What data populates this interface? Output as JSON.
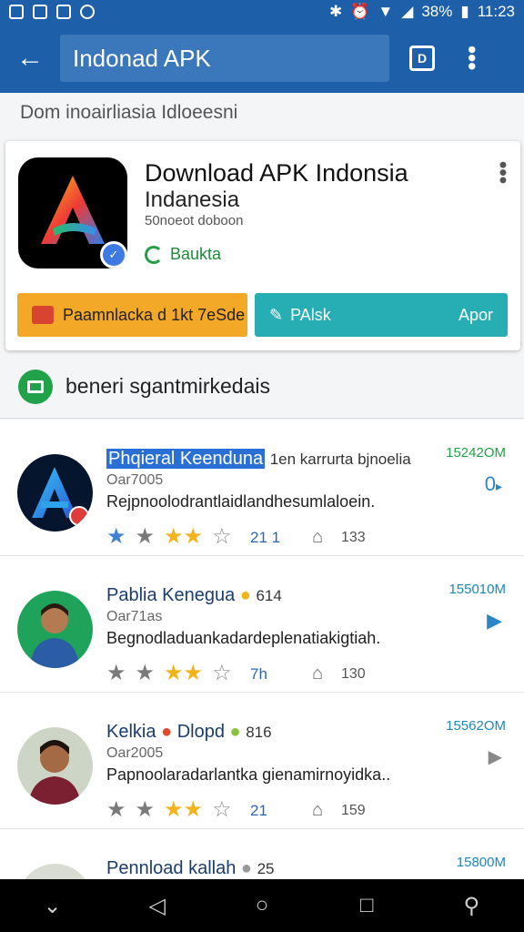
{
  "status_bar": {
    "battery": "38%",
    "time": "11:23"
  },
  "app_bar": {
    "search_text": "Indonad APK",
    "back_icon": "arrow-left-icon",
    "action_icon": "square-d-icon",
    "menu_icon": "more-vert-icon"
  },
  "subtitle": "Dom inoairliasia Idloeesni",
  "featured": {
    "title": "Download  APK Indonsia",
    "title_line2": "Indanesia",
    "developer": "50noeot doboon",
    "tag": "Baukta",
    "primary_button": "Paamnlacka d 1kt 7eSde",
    "secondary_button_left": "PAlsk",
    "secondary_button_right": "Apor"
  },
  "section": {
    "label": "beneri sgantmirkedais"
  },
  "list": [
    {
      "title_highlight": "Phqieral Keenduna",
      "title_rest": "1en karrurta bjnoelia",
      "sub": "Oar7005",
      "desc": "Rejpnoolodrantlaidlandhesumlaloein.",
      "size": "15242OM",
      "download": "0",
      "votes": "21 1",
      "count": "133"
    },
    {
      "title_highlight": "",
      "title_rest": "Pablia Kenegua",
      "title_suffix": "614",
      "sub": "Oar71as",
      "desc": "Begnodladuankadardeplenatiakigtiah.",
      "size": "155010M",
      "download": "",
      "votes": "7h",
      "count": "130"
    },
    {
      "title_highlight": "",
      "title_rest": "Kelkia",
      "title_middle": "Dlopd",
      "title_suffix": "816",
      "sub": "Oar2005",
      "desc": "Papnoolaradarlantka gienamirnoyidka..",
      "size": "15562OM",
      "download": "",
      "votes": "21",
      "count": "159"
    },
    {
      "title_rest": "Pennload kallah",
      "title_suffix": "25",
      "size": "15800M"
    }
  ],
  "colors": {
    "primary": "#1d5fa8",
    "accent_orange": "#f4a827",
    "accent_teal": "#27aeb5",
    "green": "#23a045"
  }
}
